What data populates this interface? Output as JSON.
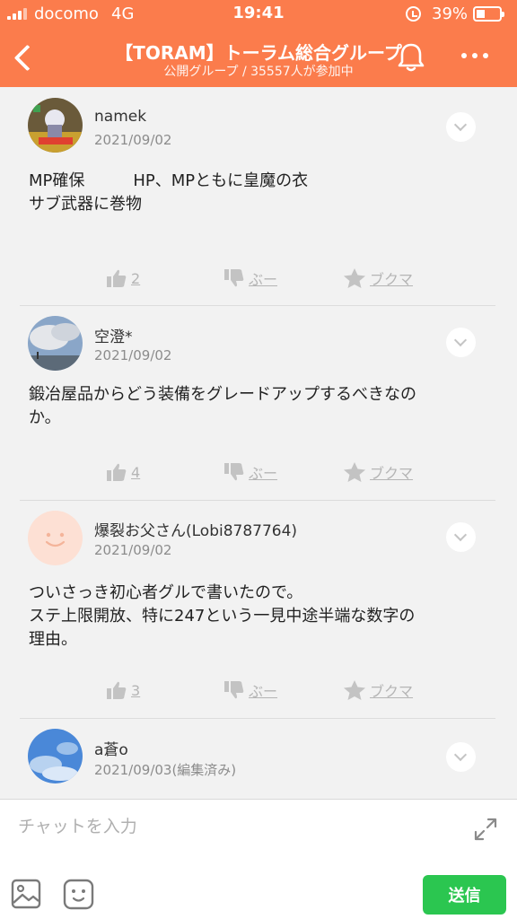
{
  "status_bar": {
    "carrier": "docomo",
    "network": "4G",
    "time": "19:41",
    "battery": "39%"
  },
  "header": {
    "title": "【TORAM】トーラム総合グループ",
    "subtitle": "公開グループ / 35557人が参加中",
    "color": "#fb7c4c"
  },
  "posts": [
    {
      "name": "namek",
      "date": "2021/09/02",
      "body": "MP確保　　　HP、MPともに皇魔の衣\nサブ武器に巻物",
      "likes": "2",
      "dislike": "ぶー",
      "bookmark": "ブクマ"
    },
    {
      "name": "空澄*",
      "date": "2021/09/02",
      "body": "鍛冶屋品からどう装備をグレードアップするべきなの\nか。",
      "likes": "4",
      "dislike": "ぶー",
      "bookmark": "ブクマ"
    },
    {
      "name": "爆裂お父さん(Lobi8787764)",
      "date": "2021/09/02",
      "body": "ついさっき初心者グルで書いたので。\nステ上限開放、特に247という一見中途半端な数字の\n理由。",
      "likes": "3",
      "dislike": "ぶー",
      "bookmark": "ブクマ"
    },
    {
      "name": "a蒼o",
      "date": "2021/09/03(編集済み)"
    }
  ],
  "composer": {
    "placeholder": "チャットを入力",
    "send_label": "送信",
    "send_color": "#2bc650"
  },
  "icons": [
    "back-icon",
    "bell-icon",
    "more-icon",
    "chevron-down-icon",
    "thumbs-up-icon",
    "thumbs-down-icon",
    "star-icon",
    "expand-icon",
    "image-icon",
    "stamp-icon"
  ]
}
